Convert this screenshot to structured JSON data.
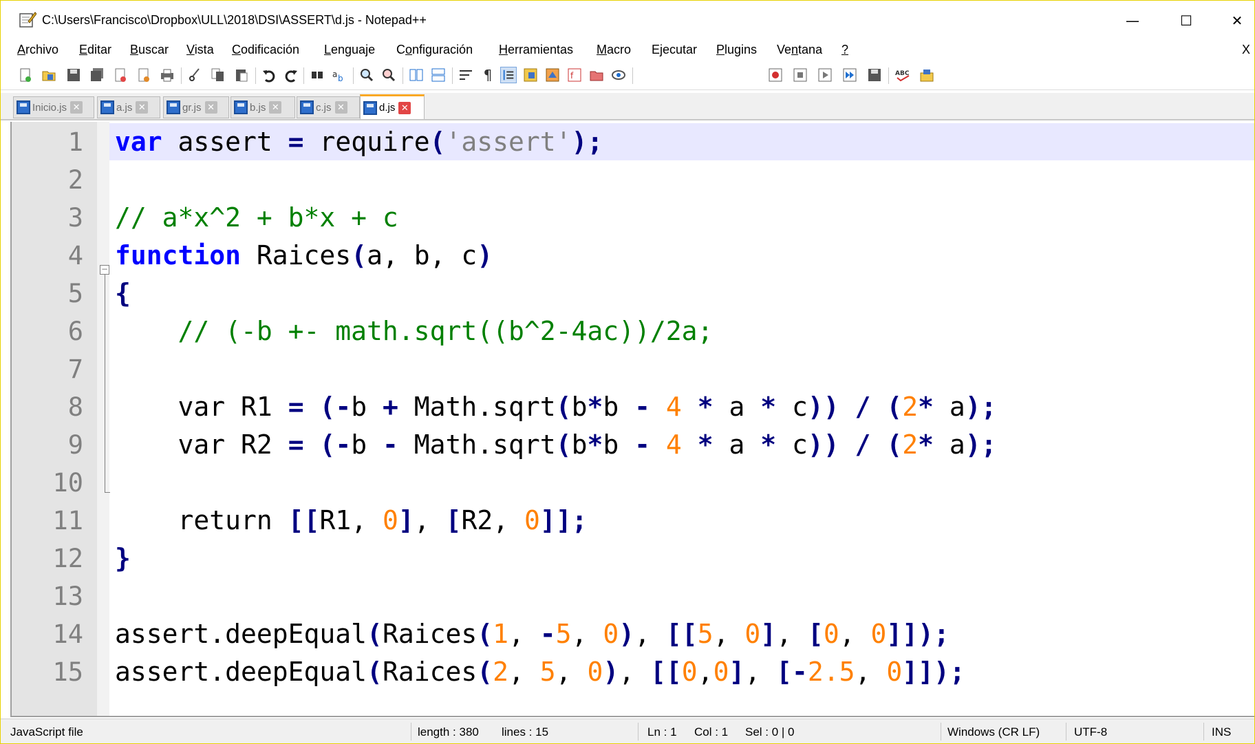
{
  "window": {
    "title": "C:\\Users\\Francisco\\Dropbox\\ULL\\2018\\DSI\\ASSERT\\d.js - Notepad++",
    "minimize_icon": "—",
    "maximize_icon": "☐",
    "close_icon": "✕"
  },
  "menu": {
    "items": [
      "Archivo",
      "Editar",
      "Buscar",
      "Vista",
      "Codificación",
      "Lenguaje",
      "Configuración",
      "Herramientas",
      "Macro",
      "Ejecutar",
      "Plugins",
      "Ventana",
      "?"
    ],
    "close_x": "X"
  },
  "toolbar": {
    "icons": [
      "new-icon",
      "open-icon",
      "save-icon",
      "save-all-icon",
      "close-icon",
      "close-all-icon",
      "print-icon",
      "cut-icon",
      "copy-icon",
      "paste-icon",
      "undo-icon",
      "redo-icon",
      "find-icon",
      "replace-icon",
      "zoom-in-icon",
      "zoom-out-icon",
      "sync-v-icon",
      "sync-h-icon",
      "word-wrap-icon",
      "show-all-chars-icon",
      "indent-guide-icon",
      "doc-map-icon",
      "function-list-icon",
      "folder-workspace-icon",
      "monitor-icon",
      "record-macro-icon",
      "stop-macro-icon",
      "play-macro-icon",
      "run-macro-multiple-icon",
      "save-macro-icon",
      "spell-check-icon",
      "plugin-icon"
    ]
  },
  "tabs": [
    {
      "label": "Inicio.js",
      "active": false
    },
    {
      "label": "a.js",
      "active": false
    },
    {
      "label": "gr.js",
      "active": false
    },
    {
      "label": "b.js",
      "active": false
    },
    {
      "label": "c.js",
      "active": false
    },
    {
      "label": "d.js",
      "active": true
    }
  ],
  "editor": {
    "line_numbers": [
      "1",
      "2",
      "3",
      "4",
      "5",
      "6",
      "7",
      "8",
      "9",
      "10",
      "11",
      "12",
      "13",
      "14",
      "15"
    ],
    "lines": [
      "var assert = require('assert');",
      "",
      "// a*x^2 + b*x + c",
      "function Raices(a, b, c)",
      "{",
      "    // (-b +- math.sqrt((b^2-4ac))/2a;",
      "",
      "    var R1 = (-b + Math.sqrt(b*b - 4 * a * c)) / (2* a);",
      "    var R2 = (-b - Math.sqrt(b*b - 4 * a * c)) / (2* a);",
      "",
      "    return [[R1, 0], [R2, 0]];",
      "}",
      "",
      "assert.deepEqual(Raices(1, -5, 0), [[5, 0], [0, 0]]);",
      "assert.deepEqual(Raices(2, 5, 0), [[0,0], [-2.5, 0]]);"
    ],
    "fold_open": "⊟"
  },
  "status": {
    "file_type": "JavaScript file",
    "length": "length : 380",
    "lines": "lines : 15",
    "ln": "Ln : 1",
    "col": "Col : 1",
    "sel": "Sel : 0 | 0",
    "eol": "Windows (CR LF)",
    "encoding": "UTF-8",
    "mode": "INS"
  },
  "colors": {
    "keyword": "#0000ff",
    "comment": "#008000",
    "number": "#ff8000",
    "string": "#808080",
    "object": "#8000ff",
    "operator": "#000080",
    "current_line": "#e8e8ff",
    "active_tab_accent": "#f9a825"
  }
}
